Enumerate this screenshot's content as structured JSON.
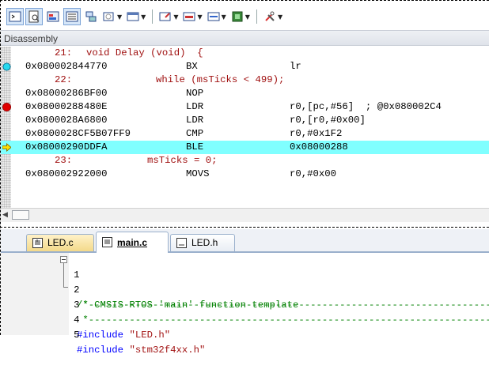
{
  "panel_title": "Disassembly",
  "disassembly": [
    {
      "kind": "src",
      "num": "21:",
      "text": "void Delay (void)  {"
    },
    {
      "kind": "asm",
      "addr": "0x08000284",
      "opcode": "4770",
      "mnemonic": "BX",
      "operands": "lr",
      "marker": "cyan-circle"
    },
    {
      "kind": "src",
      "num": "22:",
      "text": "while (msTicks < 499);"
    },
    {
      "kind": "asm",
      "addr": "0x08000286",
      "opcode": "BF00",
      "mnemonic": "NOP",
      "operands": ""
    },
    {
      "kind": "asm",
      "addr": "0x08000288",
      "opcode": "480E",
      "mnemonic": "LDR",
      "operands": "r0,[pc,#56]  ; @0x080002C4",
      "marker": "red-breakpoint"
    },
    {
      "kind": "asm",
      "addr": "0x0800028A",
      "opcode": "6800",
      "mnemonic": "LDR",
      "operands": "r0,[r0,#0x00]"
    },
    {
      "kind": "asm",
      "addr": "0x0800028C",
      "opcode": "F5B07FF9",
      "mnemonic": "CMP",
      "operands": "r0,#0x1F2"
    },
    {
      "kind": "asm",
      "addr": "0x08000290",
      "opcode": "DDFA",
      "mnemonic": "BLE",
      "operands": "0x08000288",
      "marker": "yellow-arrow",
      "highlight": true
    },
    {
      "kind": "src",
      "num": "23:",
      "text": "msTicks = 0;"
    },
    {
      "kind": "asm",
      "addr": "0x08000292",
      "opcode": "2000",
      "mnemonic": "MOVS",
      "operands": "r0,#0x00"
    }
  ],
  "tabs": [
    {
      "label": "LED.c",
      "state": "inactive"
    },
    {
      "label": "main.c",
      "state": "active"
    },
    {
      "label": "LED.h",
      "state": "plain"
    }
  ],
  "editor": {
    "lines": [
      {
        "num": "1",
        "text": "/*-----------------------------------------------------------------------",
        "type": "comment",
        "fold": "open"
      },
      {
        "num": "2",
        "text": " * CMSIS-RTOS 'main' function template",
        "type": "comment",
        "fold": "line"
      },
      {
        "num": "3",
        "text": " *-----------------------------------------------------------------------",
        "type": "comment",
        "fold": "end"
      },
      {
        "num": "4",
        "directive": "#include",
        "str": "\"LED.h\"",
        "type": "include"
      },
      {
        "num": "5",
        "directive": "#include",
        "str": "\"stm32f4xx.h\"",
        "type": "include"
      }
    ]
  },
  "toolbar_icons": [
    "command-window-icon",
    "disassembly-window-icon",
    "symbols-window-icon",
    "registers-window-icon",
    "call-stack-icon",
    "watch-windows-icon",
    "memory-windows-icon",
    "serial-windows-icon",
    "analysis-windows-icon",
    "trace-windows-icon",
    "system-viewer-icon",
    "toolbox-icon"
  ],
  "colors": {
    "highlight": "#80ffff",
    "source": "#a01010",
    "comment": "#008000",
    "directive": "#0000ff"
  }
}
